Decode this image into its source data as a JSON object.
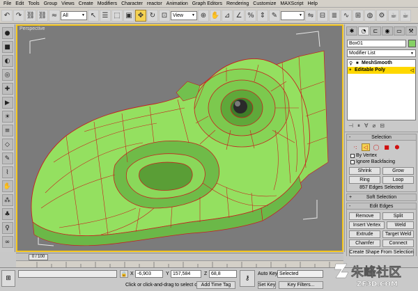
{
  "menu": [
    "File",
    "Edit",
    "Tools",
    "Group",
    "Views",
    "Create",
    "Modifiers",
    "Character",
    "reactor",
    "Animation",
    "Graph Editors",
    "Rendering",
    "Customize",
    "MAXScript",
    "Help"
  ],
  "toolbar": {
    "selection_filter": "All",
    "reference_coord": "View",
    "icons": [
      "undo-icon",
      "redo-icon",
      "link-icon",
      "unlink-icon",
      "bind-icon",
      "select-icon",
      "select-by-name-icon",
      "region-select-icon",
      "move-icon",
      "rotate-icon",
      "scale-icon",
      "pivot-icon",
      "snap-icon",
      "angle-snap-icon",
      "percent-snap-icon",
      "spinner-snap-icon",
      "named-selection-icon",
      "mirror-icon",
      "align-icon",
      "layer-icon",
      "curve-editor-icon",
      "schematic-icon",
      "material-editor-icon",
      "render-setup-icon",
      "render-icon"
    ]
  },
  "viewport": {
    "label": "Perspective",
    "border_color": "#f2c41c",
    "mesh_color": "#8ee05a",
    "mesh_dark": "#5fae3c",
    "edge_color": "#c81e1e"
  },
  "command_panel": {
    "object_name": "Box01",
    "object_color": "#86d164",
    "modifier_list": "Modifier List",
    "stack": [
      {
        "label": "MeshSmooth",
        "selected": false
      },
      {
        "label": "Editable Poly",
        "selected": true
      }
    ],
    "selection": {
      "title": "Selection",
      "by_vertex": "By Vertex",
      "ignore_backfacing": "Ignore Backfacing",
      "shrink": "Shrink",
      "grow": "Grow",
      "ring": "Ring",
      "loop": "Loop",
      "status": "857 Edges Selected"
    },
    "soft_selection": {
      "title": "Soft Selection"
    },
    "edit_edges": {
      "title": "Edit Edges",
      "remove": "Remove",
      "split": "Split",
      "insert_vertex": "Insert Vertex",
      "weld": "Weld",
      "extrude": "Extrude",
      "target_weld": "Target Weld",
      "chamfer": "Chamfer",
      "connect": "Connect",
      "create_shape": "Create Shape From Selection"
    }
  },
  "timeline": {
    "frame": "0 / 100"
  },
  "status": {
    "x_label": "X",
    "x_value": "-6,903",
    "y_label": "Y",
    "y_value": "157,584",
    "z_label": "Z",
    "z_value": "68,8",
    "prompt": "Click or click-and-drag to select ob",
    "add_time_tag": "Add Time Tag",
    "auto_key": "Auto Key",
    "set_key": "Set Key",
    "selected": "Selected",
    "key_filters": "Key Filters..."
  },
  "watermark": {
    "line1": "朱峰社区",
    "line2": "ZF3D.COM"
  }
}
